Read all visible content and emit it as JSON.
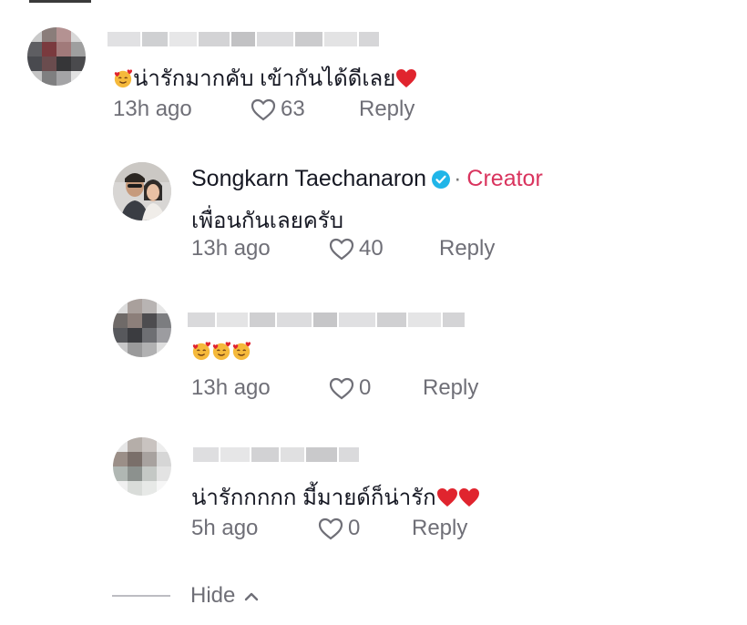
{
  "comments": [
    {
      "text": "น่ารักมากคับ เข้ากันได้ดีเลย",
      "time": "13h ago",
      "likes": "63",
      "reply": "Reply"
    },
    {
      "username": "Songkarn Taechanaron",
      "badge_separator": "·",
      "role": "Creator",
      "text": "เพื่อนกันเลยครับ",
      "time": "13h ago",
      "likes": "40",
      "reply": "Reply"
    },
    {
      "text": "",
      "time": "13h ago",
      "likes": "0",
      "reply": "Reply"
    },
    {
      "text": "น่ารักกกกก มี้มายด์ก็น่ารัก",
      "time": "5h ago",
      "likes": "0",
      "reply": "Reply"
    }
  ],
  "footer": {
    "hide_label": "Hide"
  },
  "colors": {
    "creator": "#d9345e",
    "verified": "#20b5e8",
    "heart_emoji": "#e0242e",
    "meta": "#6f6f77"
  },
  "icons": {
    "like": "heart-outline-icon",
    "verified": "verified-badge-icon",
    "hide": "chevron-up-icon",
    "emoji_smile": "smiling-face-with-hearts-emoji",
    "emoji_heart": "red-heart-emoji"
  }
}
